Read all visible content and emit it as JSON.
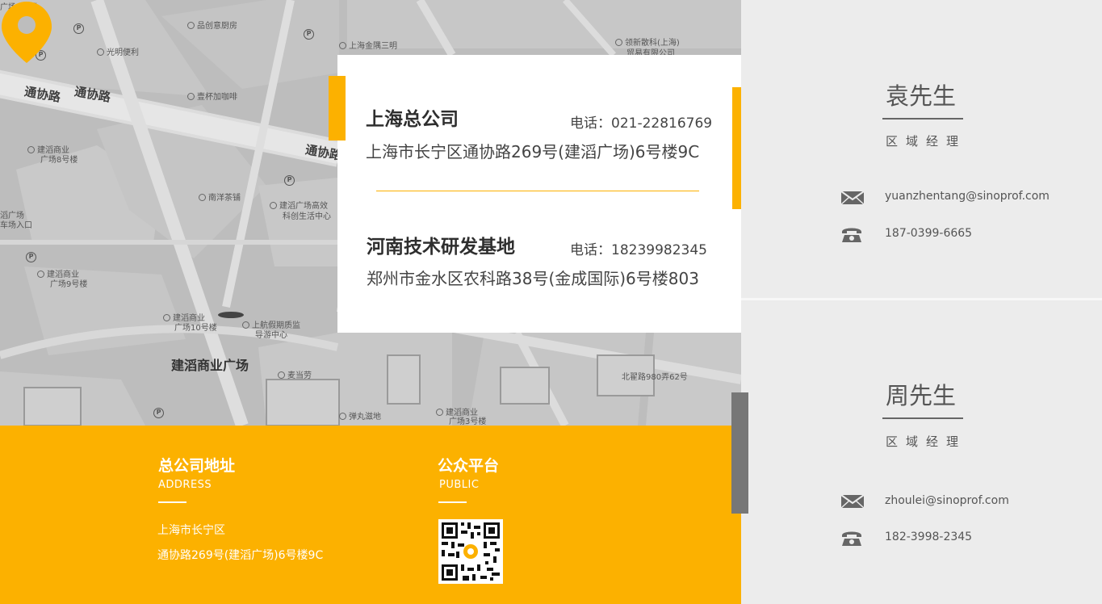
{
  "map": {
    "roads": [
      "通协路",
      "通协路",
      "通协路"
    ],
    "places": [
      "品创意厨房",
      "光明便利",
      "上海金隅三明",
      "领新散科(上海)",
      "贸易有限公司",
      "壹杯加咖啡",
      "建滔商业",
      "广场8号楼",
      "南洋茶铺",
      "建滔广场高效",
      "科创生活中心",
      "建滔商业",
      "广场9号楼",
      "建滔商业",
      "广场10号楼",
      "上航假期质监",
      "导游中心",
      "麦当劳",
      "弹丸滋地",
      "建滔商业",
      "广场3号楼",
      "北翟路980弄62号",
      "滔广场",
      "车场入口",
      "广场3号楼"
    ],
    "landmark": "建滔商业广场",
    "pin_icon": "location-pin-icon",
    "parking_icon": "P"
  },
  "offices": [
    {
      "name": "上海总公司",
      "phone": "电话：021-22816769",
      "address": "上海市长宁区通协路269号(建滔广场)6号楼9C"
    },
    {
      "name": "河南技术研发基地",
      "phone": "电话：18239982345",
      "address": "郑州市金水区农科路38号(金成国际)6号楼803"
    }
  ],
  "footer": {
    "hq_title": "总公司地址",
    "hq_sub": "ADDRESS",
    "hq_line1": "上海市长宁区",
    "hq_line2": "通协路269号(建滔广场)6号楼9C",
    "public_title": "公众平台",
    "public_sub": "PUBLIC",
    "qr_icon": "qr-code-icon"
  },
  "contacts": [
    {
      "name": "袁先生",
      "role": "区域经理",
      "email": "yuanzhentang@sinoprof.com",
      "phone": "187-0399-6665"
    },
    {
      "name": "周先生",
      "role": "区域经理",
      "email": "zhoulei@sinoprof.com",
      "phone": "182-3998-2345"
    }
  ],
  "colors": {
    "accent": "#fcb100",
    "panel": "#ececec",
    "map": "#bdbdbd"
  }
}
